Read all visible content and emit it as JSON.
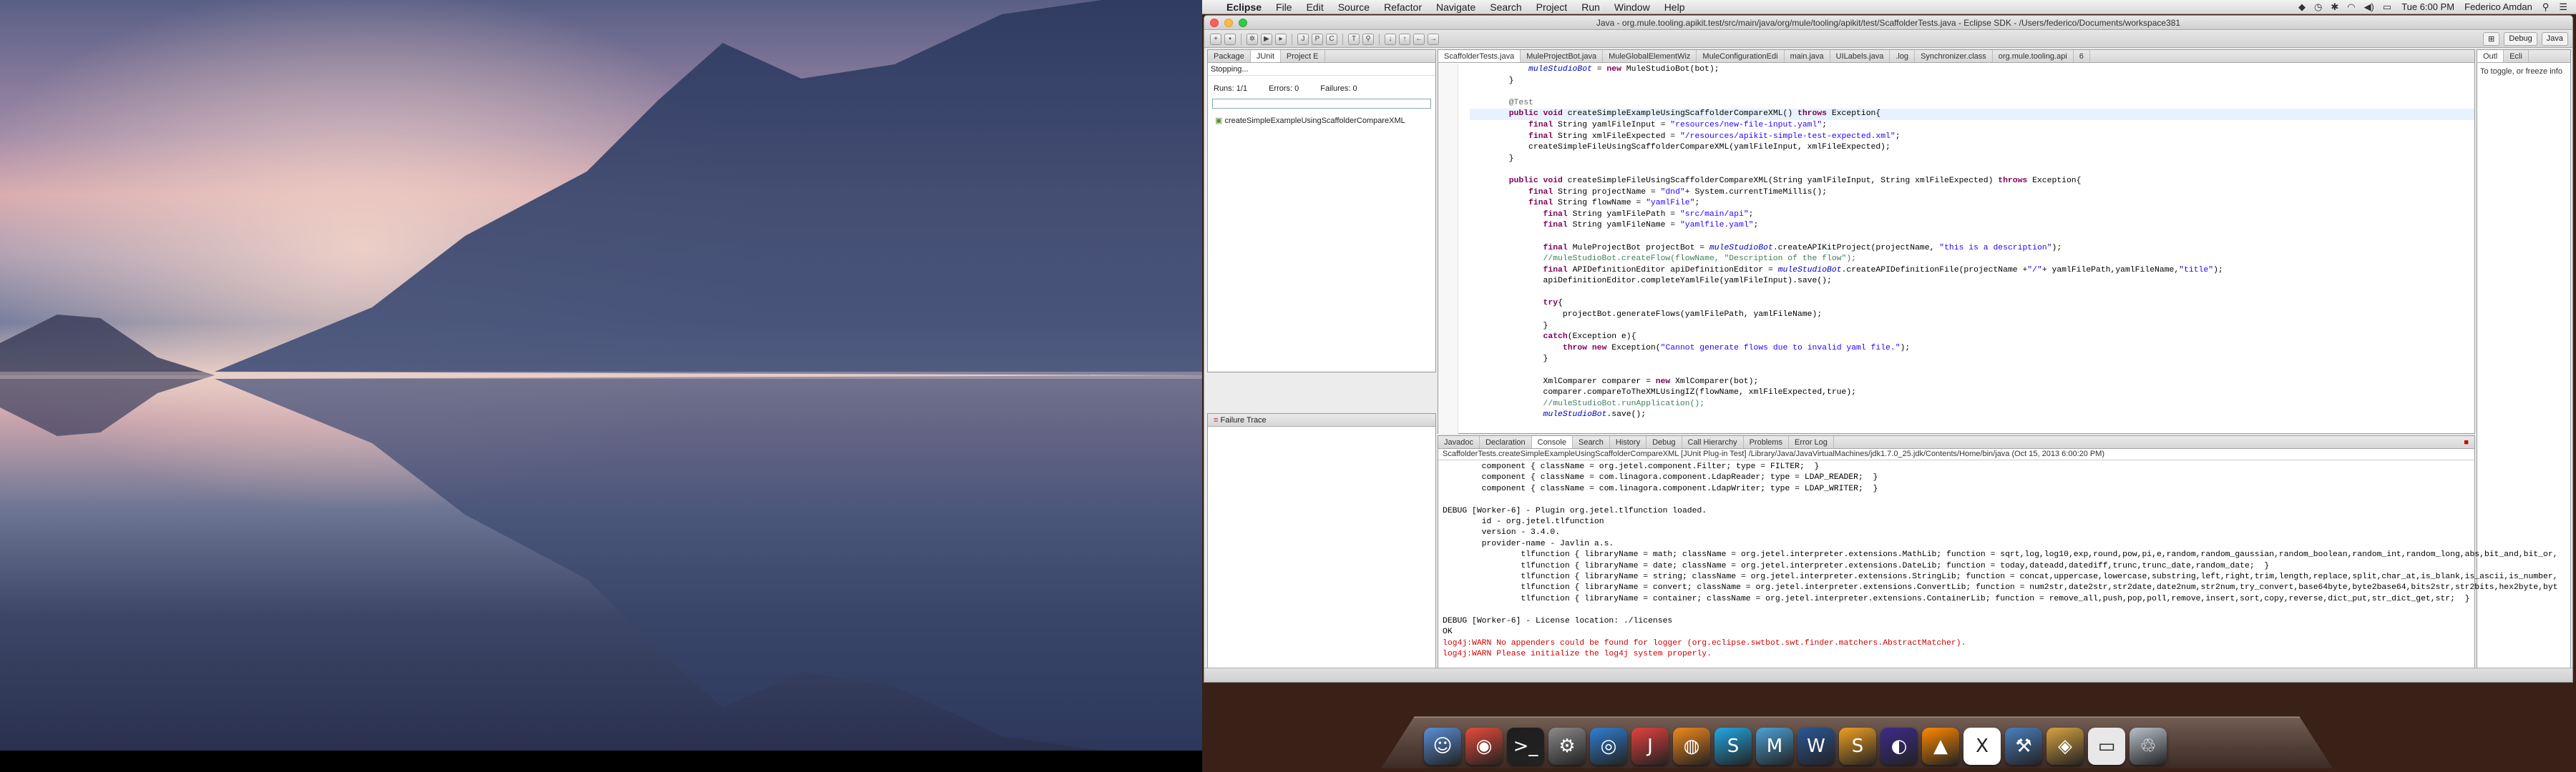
{
  "menubar": {
    "apple": "",
    "app_name": "Eclipse",
    "menus": [
      "File",
      "Edit",
      "Source",
      "Refactor",
      "Navigate",
      "Search",
      "Project",
      "Run",
      "Window",
      "Help"
    ],
    "clock": "Tue 6:00 PM",
    "user": "Federico Amdan"
  },
  "window": {
    "title": "Java - org.mule.tooling.apikit.test/src/main/java/org/mule/tooling/apikit/test/ScaffolderTests.java - Eclipse SDK - /Users/federico/Documents/workspace381",
    "perspectives": [
      "Debug",
      "Java"
    ]
  },
  "left_panel": {
    "tabs": [
      "Package",
      "JUnit",
      "Project E"
    ],
    "status": "Stopping...",
    "runs": "Runs: 1/1",
    "errors": "Errors: 0",
    "failures": "Failures: 0",
    "test_item": "createSimpleExampleUsingScaffolderCompareXML",
    "failure_trace": "Failure Trace"
  },
  "editor": {
    "tabs": [
      "ScaffolderTests.java",
      "MuleProjectBot.java",
      "MuleGlobalElementWiz",
      "MuleConfigurationEdi",
      "main.java",
      "UILabels.java",
      ".log",
      "Synchronizer.class",
      "org.mule.tooling.api",
      "6"
    ]
  },
  "outline": {
    "tabs": [
      "Outl",
      "Ecli"
    ],
    "text": "To toggle, or freeze info"
  },
  "console": {
    "tabs": [
      "Javadoc",
      "Declaration",
      "Console",
      "Search",
      "History",
      "Debug",
      "Call Hierarchy",
      "Problems",
      "Error Log"
    ],
    "header": "ScaffolderTests.createSimpleExampleUsingScaffolderCompareXML [JUnit Plug-in Test] /Library/Java/JavaVirtualMachines/jdk1.7.0_25.jdk/Contents/Home/bin/java (Oct 15, 2013 6:00:20 PM)",
    "lines": [
      "        component { className = org.jetel.component.Filter; type = FILTER;  }",
      "        component { className = com.linagora.component.LdapReader; type = LDAP_READER;  }",
      "        component { className = com.linagora.component.LdapWriter; type = LDAP_WRITER;  }",
      "",
      "DEBUG [Worker-6] - Plugin org.jetel.tlfunction loaded.",
      "        id - org.jetel.tlfunction",
      "        version - 3.4.0.",
      "        provider-name - Javlin a.s.",
      "                tlfunction { libraryName = math; className = org.jetel.interpreter.extensions.MathLib; function = sqrt,log,log10,exp,round,pow,pi,e,random,random_gaussian,random_boolean,random_int,random_long,abs,bit_and,bit_or,",
      "                tlfunction { libraryName = date; className = org.jetel.interpreter.extensions.DateLib; function = today,dateadd,datediff,trunc,trunc_date,random_date;  }",
      "                tlfunction { libraryName = string; className = org.jetel.interpreter.extensions.StringLib; function = concat,uppercase,lowercase,substring,left,right,trim,length,replace,split,char_at,is_blank,is_ascii,is_number,",
      "                tlfunction { libraryName = convert; className = org.jetel.interpreter.extensions.ConvertLib; function = num2str,date2str,str2date,date2num,str2num,try_convert,base64byte,byte2base64,bits2str,str2bits,hex2byte,byt",
      "                tlfunction { libraryName = container; className = org.jetel.interpreter.extensions.ContainerLib; function = remove_all,push,pop,poll,remove,insert,sort,copy,reverse,dict_put,str_dict_get,str;  }",
      "",
      "DEBUG [Worker-6] - License location: ./licenses",
      "OK"
    ],
    "errors": [
      "log4j:WARN No appenders could be found for logger (org.eclipse.swtbot.swt.finder.matchers.AbstractMatcher).",
      "log4j:WARN Please initialize the log4j system properly."
    ]
  },
  "code": [
    "            muleStudioBot = new MuleStudioBot(bot);",
    "        }",
    "",
    "        @Test",
    "        public void createSimpleExampleUsingScaffolderCompareXML() throws Exception{",
    "            final String yamlFileInput = \"resources/new-file-input.yaml\";",
    "            final String xmlFileExpected = \"/resources/apikit-simple-test-expected.xml\";",
    "            createSimpleFileUsingScaffolderCompareXML(yamlFileInput, xmlFileExpected);",
    "        }",
    "",
    "        public void createSimpleFileUsingScaffolderCompareXML(String yamlFileInput, String xmlFileExpected) throws Exception{",
    "            final String projectName = \"dnd\"+ System.currentTimeMillis();",
    "            final String flowName = \"yamlFile\";",
    "               final String yamlFilePath = \"src/main/api\";",
    "               final String yamlFileName = \"yamlfile.yaml\";",
    "",
    "               final MuleProjectBot projectBot = muleStudioBot.createAPIKitProject(projectName, \"this is a description\");",
    "               //muleStudioBot.createFlow(flowName, \"Description of the flow\");",
    "               final APIDefinitionEditor apiDefinitionEditor = muleStudioBot.createAPIDefinitionFile(projectName +\"/\"+ yamlFilePath,yamlFileName,\"title\");",
    "               apiDefinitionEditor.completeYamlFile(yamlFileInput).save();",
    "",
    "               try{",
    "                   projectBot.generateFlows(yamlFilePath, yamlFileName);",
    "               }",
    "               catch(Exception e){",
    "                   throw new Exception(\"Cannot generate flows due to invalid yaml file.\");",
    "               }",
    "",
    "               XmlComparer comparer = new XmlComparer(bot);",
    "               comparer.compareToTheXMLUsingIZ(flowName, xmlFileExpected,true);",
    "               //muleStudioBot.runApplication();",
    "               muleStudioBot.save();"
  ],
  "dock": {
    "icons": [
      "finder-icon",
      "chrome-icon",
      "terminal-icon",
      "system-prefs-icon",
      "safari-icon",
      "intellij-icon",
      "firefox-icon",
      "skype-icon",
      "mule-studio-icon",
      "word-icon",
      "sublime-text-icon",
      "eclipse-icon",
      "vlc-icon",
      "x-app-icon",
      "xcode-icon",
      "preview-icon",
      "documents-icon",
      "trash-icon"
    ],
    "colors": [
      "#5a8fd6",
      "#e84a3a",
      "#1e1e1e",
      "#8a8a8a",
      "#2f7fd3",
      "#e5413f",
      "#f08a1c",
      "#21a9e6",
      "#4ba3d8",
      "#2b5797",
      "#f0a023",
      "#3d2b8c",
      "#ff8800",
      "#ffffff",
      "#4b7fbf",
      "#d9a441",
      "#e8e8e8",
      "#b8c2cc"
    ],
    "glyphs": [
      "☺",
      "◉",
      ">_",
      "⚙",
      "◎",
      "J",
      "◍",
      "S",
      "M",
      "W",
      "S",
      "◐",
      "▲",
      "X",
      "⚒",
      "◈",
      "▭",
      "♲"
    ]
  }
}
